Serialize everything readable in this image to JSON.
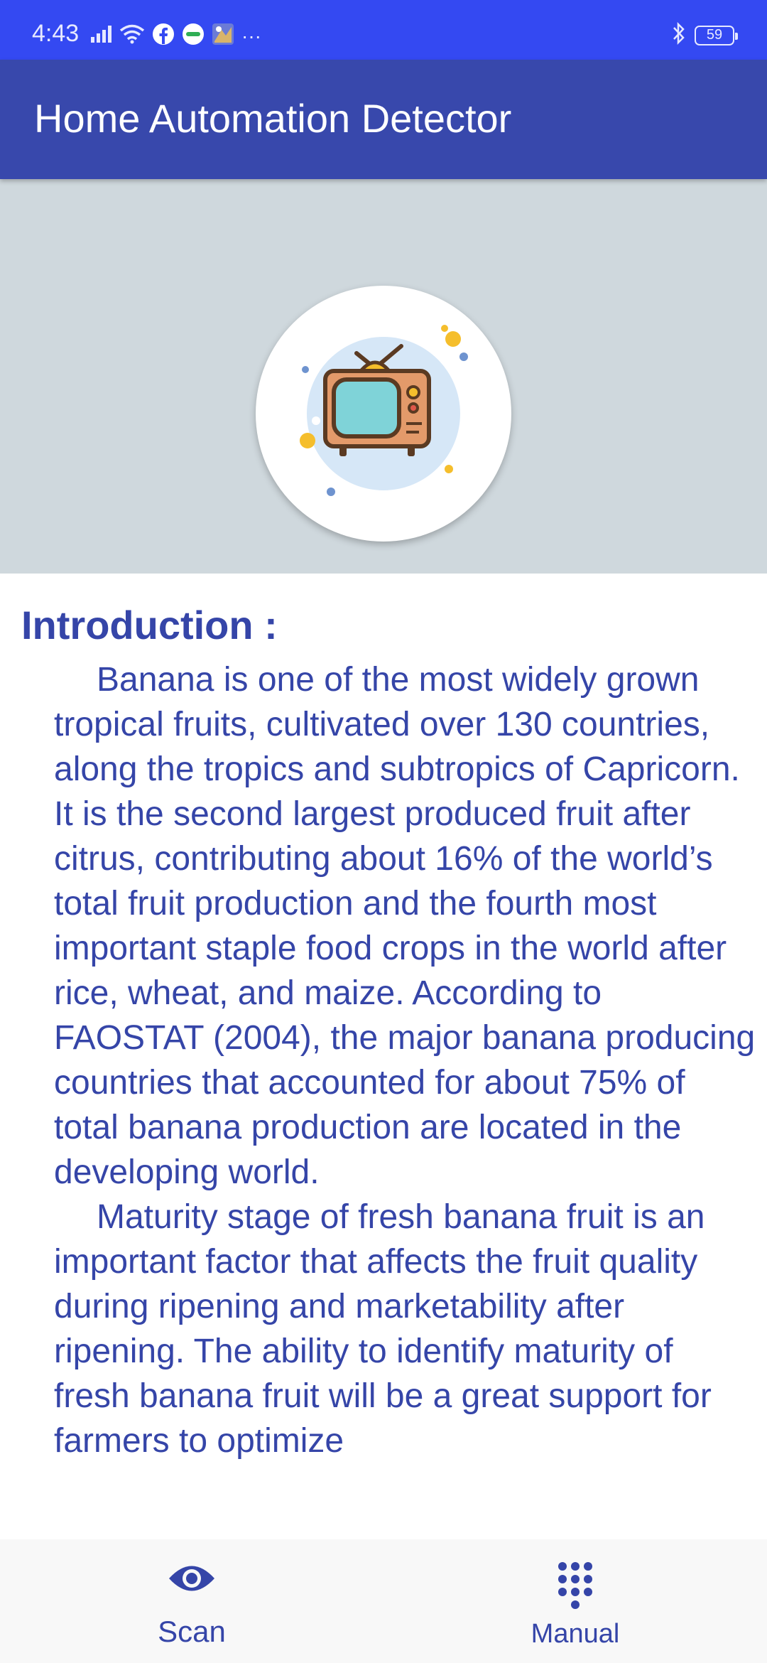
{
  "status_bar": {
    "time": "4:43",
    "battery": "59",
    "icons": [
      "signal-icon",
      "wifi-icon",
      "facebook-icon",
      "grab-icon",
      "game-icon",
      "more-icon",
      "bluetooth-icon",
      "battery-icon"
    ],
    "more_glyph": "···"
  },
  "app_bar": {
    "title": "Home Automation Detector"
  },
  "hero": {
    "icon": "tv-icon"
  },
  "content": {
    "heading": "Introduction :",
    "paragraphs": [
      "Banana is one of the most widely grown tropical fruits, cultivated over 130 countries, along the tropics and subtropics of Capricorn. It is the second largest produced fruit after citrus, contributing about 16% of the world’s total fruit production and the fourth most important staple food crops in the world after rice, wheat, and maize. According to FAOSTAT (2004), the major banana producing countries that accounted for about 75% of total banana production are located in the developing world.",
      "Maturity stage of fresh banana fruit is an important factor that affects the fruit quality during ripening and marketability after ripening. The ability to identify maturity of fresh banana fruit will be a great support for farmers to optimize"
    ]
  },
  "bottom_nav": {
    "items": [
      {
        "label": "Scan",
        "icon": "eye-icon"
      },
      {
        "label": "Manual",
        "icon": "dialpad-icon"
      }
    ]
  },
  "colors": {
    "status_bar": "#3449f2",
    "app_bar": "#3848ac",
    "hero_bg": "#cfd8dd",
    "text": "#3545a8",
    "nav_bg": "#f8f8f8"
  }
}
